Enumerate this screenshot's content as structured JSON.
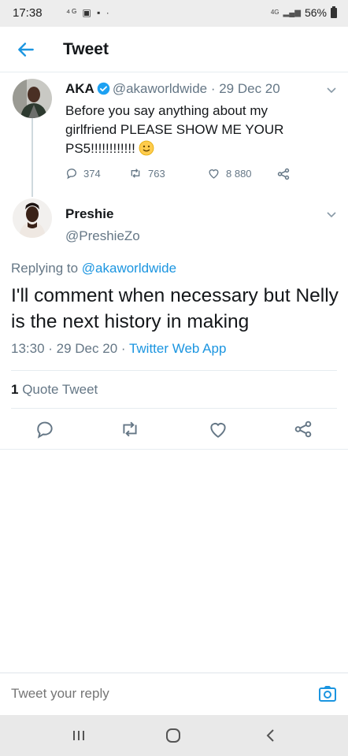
{
  "status_bar": {
    "time": "17:38",
    "left_icons": "⁴ᴳ ▣ ▪ ·",
    "network": "4G",
    "battery": "56%"
  },
  "header": {
    "title": "Tweet",
    "back_icon": "arrow-left-icon"
  },
  "parent_tweet": {
    "name": "AKA",
    "verified": true,
    "handle_date": "@akaworldwide · 29 Dec 20",
    "text": "Before you say anything about my girlfriend PLEASE SHOW ME YOUR PS5!!!!!!!!!!!!",
    "emoji": "slightly-smiling-face",
    "replies": "374",
    "retweets": "763",
    "likes": "8 880"
  },
  "reply_tweet": {
    "name": "Preshie",
    "handle": "@PreshieZo",
    "replying_prefix": "Replying to ",
    "replying_to": "@akaworldwide",
    "text": "I'll comment when necessary  but Nelly is the next history in making",
    "timestamp": "13:30 · 29 Dec 20 · ",
    "source_app": "Twitter Web App",
    "quote_count": "1",
    "quote_label": " Quote Tweet"
  },
  "reply_bar": {
    "placeholder": "Tweet your reply",
    "camera_icon": "camera-icon"
  },
  "colors": {
    "accent": "#1b95e0",
    "secondary_text": "#657786",
    "divider": "#e6ecf0"
  }
}
